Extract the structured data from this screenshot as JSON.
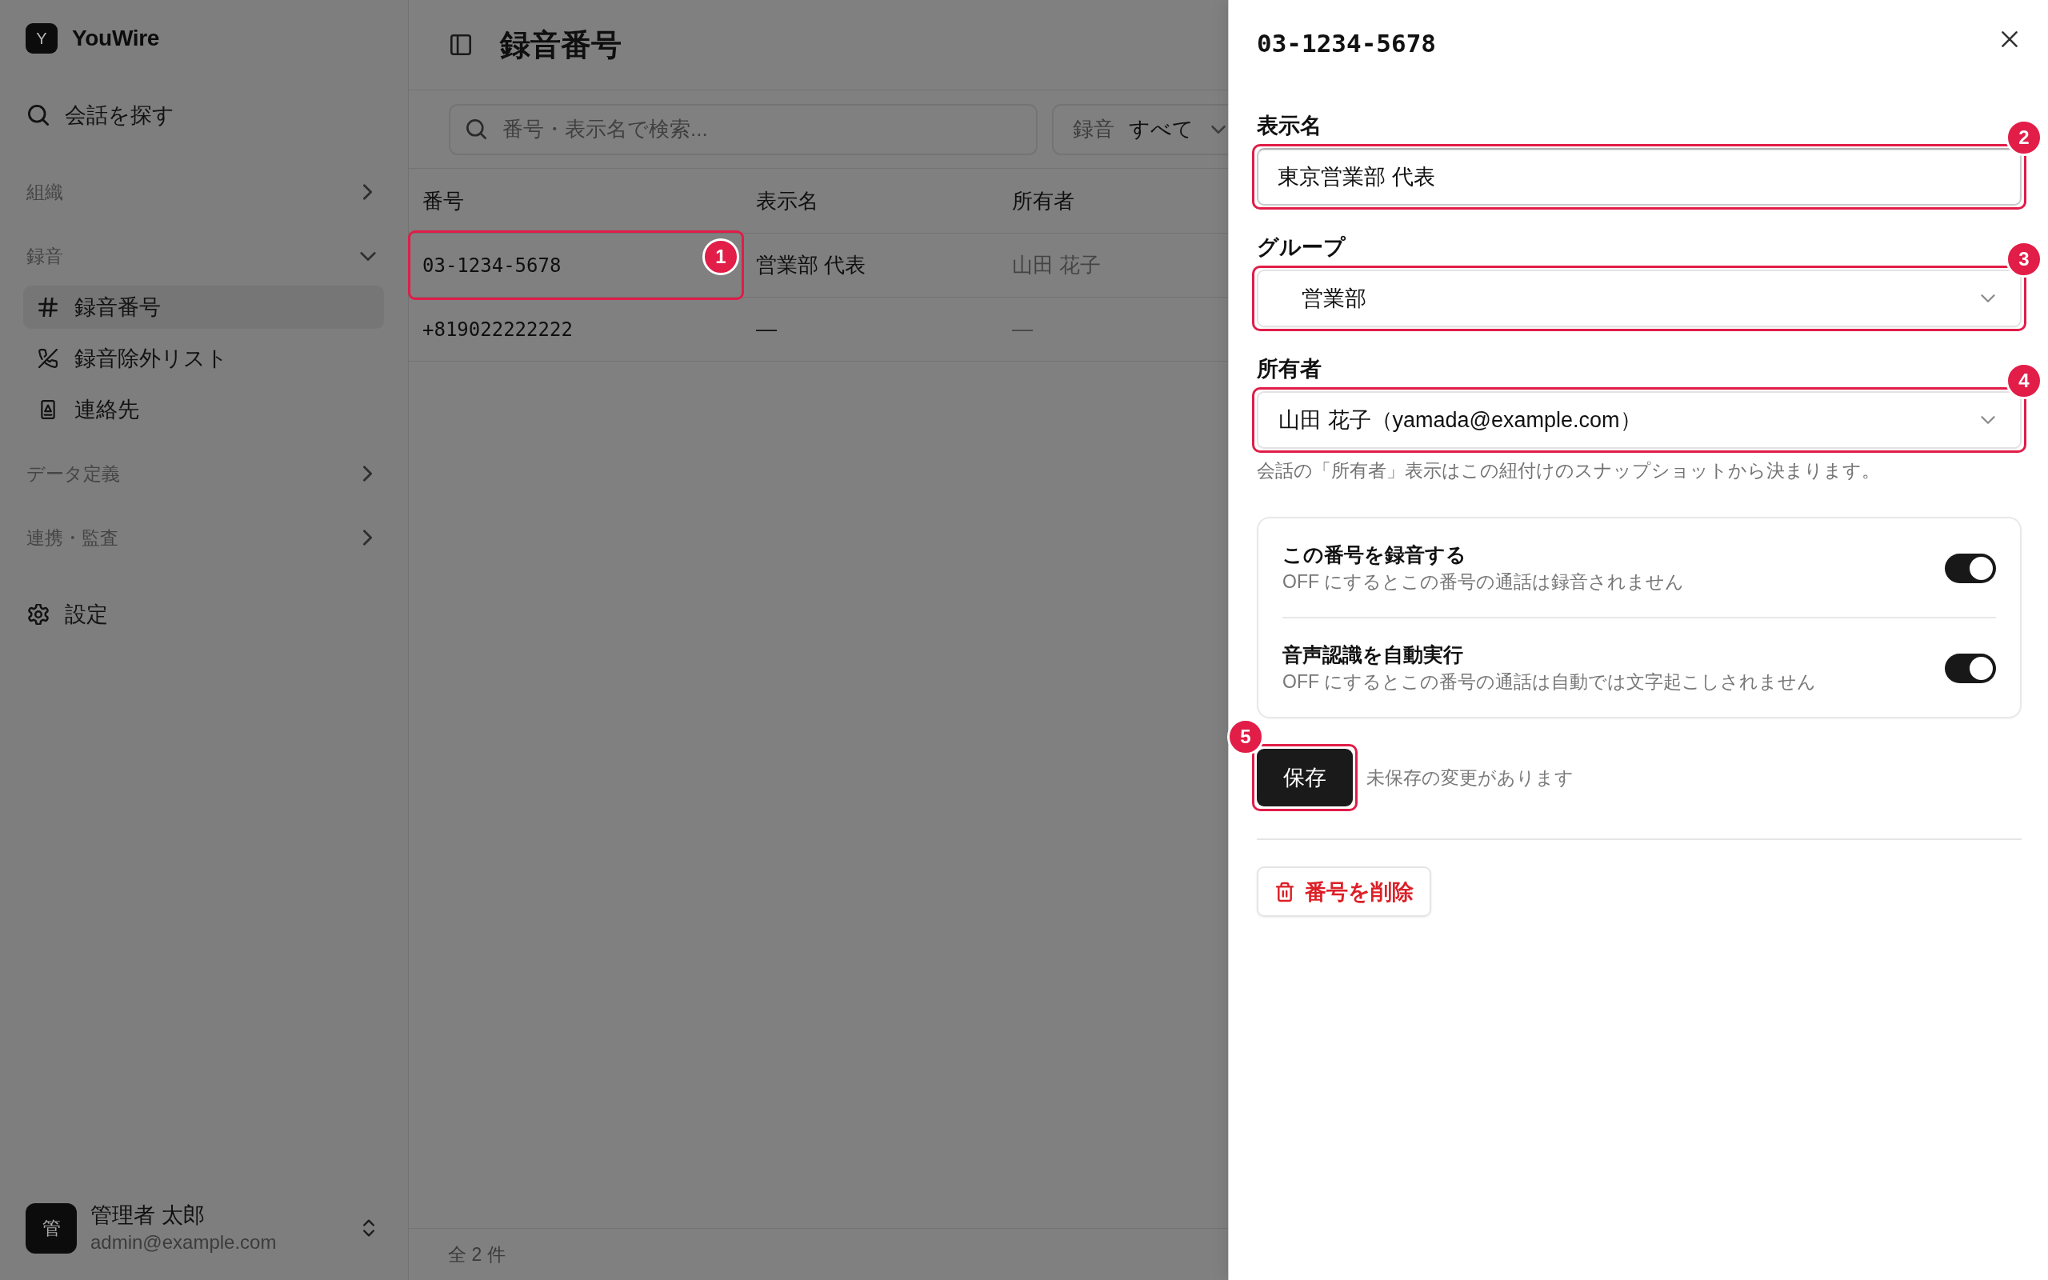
{
  "sidebar": {
    "brand": {
      "letter": "Y",
      "name": "YouWire"
    },
    "search": {
      "label": "会話を探す"
    },
    "sections": [
      {
        "label": "組織",
        "expanded": false
      },
      {
        "label": "録音",
        "expanded": true,
        "children": [
          {
            "label": "録音番号",
            "selected": true
          },
          {
            "label": "録音除外リスト",
            "selected": false
          },
          {
            "label": "連絡先",
            "selected": false
          }
        ]
      },
      {
        "label": "データ定義",
        "expanded": false
      },
      {
        "label": "連携・監査",
        "expanded": false
      }
    ],
    "settings": {
      "label": "設定"
    },
    "user": {
      "initial": "管",
      "name": "管理者 太郎",
      "email": "admin@example.com"
    }
  },
  "main": {
    "title": "録音番号",
    "search": {
      "placeholder": "番号・表示名で検索..."
    },
    "filter": {
      "label": "録音",
      "value": "すべて"
    },
    "table": {
      "columns": [
        "番号",
        "表示名",
        "所有者"
      ],
      "rows": [
        {
          "number": "03-1234-5678",
          "display_name": "営業部 代表",
          "owner": "山田 花子",
          "callout": "1"
        },
        {
          "number": "+819022222222",
          "display_name": "—",
          "owner": "—"
        }
      ]
    },
    "footer": "全 2 件"
  },
  "panel": {
    "title": "03-1234-5678",
    "fields": [
      {
        "kind": "text",
        "label": "表示名",
        "value": "東京営業部 代表",
        "callout": "2"
      },
      {
        "kind": "group",
        "label": "グループ",
        "value": "営業部",
        "callout": "3"
      },
      {
        "kind": "select",
        "label": "所有者",
        "value": "山田 花子（yamada@example.com）",
        "hint": "会話の「所有者」表示はこの紐付けのスナップショットから決まります。",
        "callout": "4"
      }
    ],
    "toggles": [
      {
        "title": "この番号を録音する",
        "description": "OFF にするとこの番号の通話は録音されません",
        "on": true
      },
      {
        "title": "音声認識を自動実行",
        "description": "OFF にするとこの番号の通話は自動では文字起こしされません",
        "on": true
      }
    ],
    "save": {
      "label": "保存",
      "callout": "5"
    },
    "unsaved_note": "未保存の変更があります",
    "delete": {
      "label": "番号を削除"
    }
  }
}
